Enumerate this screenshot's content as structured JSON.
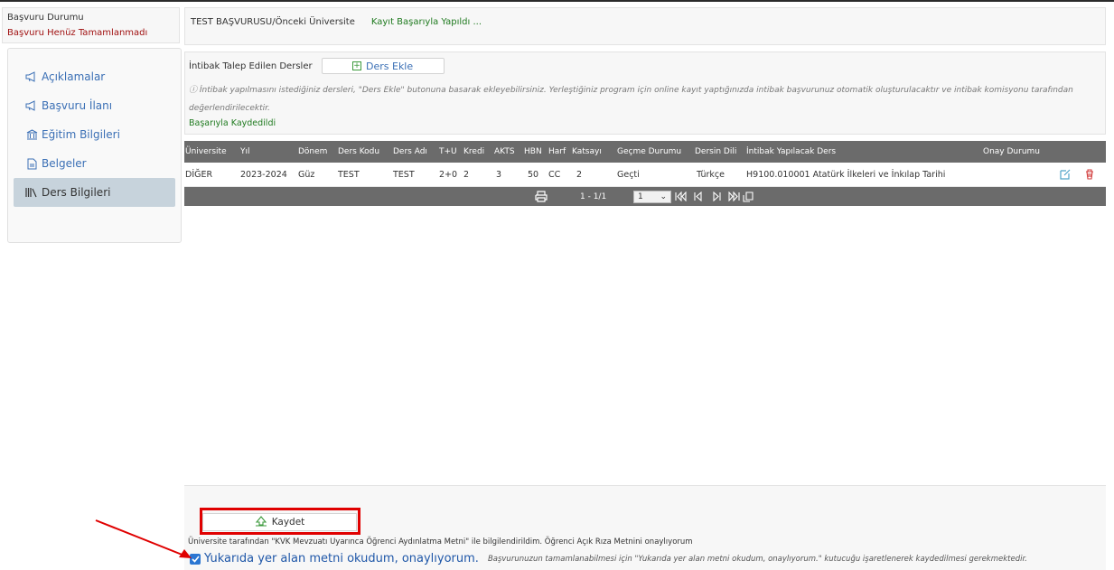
{
  "status": {
    "title": "Başvuru Durumu",
    "value": "Başvuru Henüz Tamamlanmadı"
  },
  "sidebar": {
    "items": [
      {
        "label": "Açıklamalar",
        "icon": "megaphone-icon"
      },
      {
        "label": "Başvuru İlanı",
        "icon": "megaphone-icon"
      },
      {
        "label": "Eğitim Bilgileri",
        "icon": "university-icon"
      },
      {
        "label": "Belgeler",
        "icon": "document-icon"
      },
      {
        "label": "Ders Bilgileri",
        "icon": "books-icon",
        "active": true
      }
    ]
  },
  "header": {
    "application": "TEST BAŞVURUSU/Önceki Üniversite",
    "status": "Kayıt Başarıyla Yapıldı ..."
  },
  "intibak": {
    "label": "İntibak Talep Edilen Dersler",
    "add_button": "Ders Ekle",
    "info_line1": "ⓘ İntibak yapılmasını istediğiniz dersleri, \"Ders Ekle\" butonuna basarak ekleyebilirsiniz. Yerleştiğiniz program için online kayıt yaptığınızda intibak başvurunuz otomatik oluşturulacaktır ve intibak komisyonu tarafından",
    "info_line2": "değerlendirilecektir.",
    "saved": "Başarıyla Kaydedildi"
  },
  "table": {
    "columns": [
      "Üniversite",
      "Yıl",
      "Dönem",
      "Ders Kodu",
      "Ders Adı",
      "T+U",
      "Kredi",
      "AKTS",
      "HBN",
      "Harf",
      "Katsayı",
      "Geçme Durumu",
      "Dersin Dili",
      "İntibak Yapılacak Ders",
      "Onay Durumu"
    ],
    "rows": [
      [
        "DİĞER",
        "2023-2024",
        "Güz",
        "TEST",
        "TEST",
        "2+0",
        "2",
        "3",
        "50",
        "CC",
        "2",
        "Geçti",
        "Türkçe",
        "H9100.010001 Atatürk İlkeleri ve İnkılap Tarihi",
        ""
      ]
    ],
    "pager": {
      "range": "1 - 1/1",
      "page": "1"
    }
  },
  "footer": {
    "save_button": "Kaydet",
    "kvk_text": "Üniversite tarafından \"KVK Mevzuatı Uyarınca Öğrenci Aydınlatma Metni\" ile bilgilendirildim. Öğrenci Açık Rıza Metnini onaylıyorum",
    "consent_label": "Yukarıda yer alan metni okudum, onaylıyorum.",
    "consent_note": "Başvurunuzun tamamlanabilmesi için \"Yukarıda yer alan metni okudum, onaylıyorum.\" kutucuğu işaretlenerek kaydedilmesi gerekmektedir.",
    "consent_checked": true
  },
  "colors": {
    "accent": "#3a6fb5",
    "success": "#1f7a1f",
    "error": "#a01010",
    "highlight": "#e00000",
    "table_header": "#6b6b6b"
  }
}
